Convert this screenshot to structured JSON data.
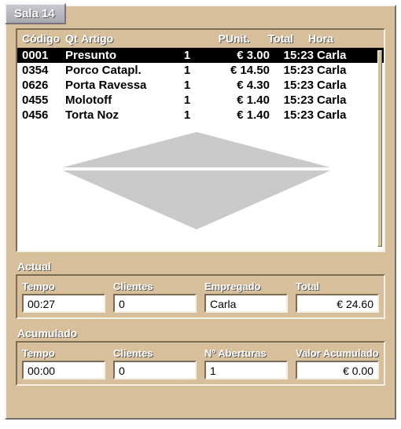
{
  "window": {
    "title": "Sala 14"
  },
  "columns": {
    "codigo": "Código",
    "qt": "Qt",
    "artigo": "Artigo",
    "punit": "PUnit.",
    "total": "Total",
    "hora": "Hora"
  },
  "rows": [
    {
      "codigo": "0001",
      "artigo": "Presunto",
      "qt": "1",
      "punit": "€ 3.00",
      "time": "15:23",
      "user": "Carla",
      "selected": true
    },
    {
      "codigo": "0354",
      "artigo": "Porco Catapl.",
      "qt": "1",
      "punit": "€ 14.50",
      "time": "15:23",
      "user": "Carla",
      "selected": false
    },
    {
      "codigo": "0626",
      "artigo": "Porta Ravessa",
      "qt": "1",
      "punit": "€ 4.30",
      "time": "15:23",
      "user": "Carla",
      "selected": false
    },
    {
      "codigo": "0455",
      "artigo": "Molotoff",
      "qt": "1",
      "punit": "€ 1.40",
      "time": "15:23",
      "user": "Carla",
      "selected": false
    },
    {
      "codigo": "0456",
      "artigo": "Torta Noz",
      "qt": "1",
      "punit": "€ 1.40",
      "time": "15:23",
      "user": "Carla",
      "selected": false
    }
  ],
  "sections": {
    "actual": {
      "label": "Actual",
      "tempo_label": "Tempo",
      "tempo": "00:27",
      "clientes_label": "Clientes",
      "clientes": "0",
      "empregado_label": "Empregado",
      "empregado": "Carla",
      "total_label": "Total",
      "total": "€ 24.60"
    },
    "acumulado": {
      "label": "Acumulado",
      "tempo_label": "Tempo",
      "tempo": "00:00",
      "clientes_label": "Clientes",
      "clientes": "0",
      "aberturas_label": "Nº Aberturas",
      "aberturas": "1",
      "valor_label": "Valor Acumulado",
      "valor": "€ 0.00"
    }
  }
}
